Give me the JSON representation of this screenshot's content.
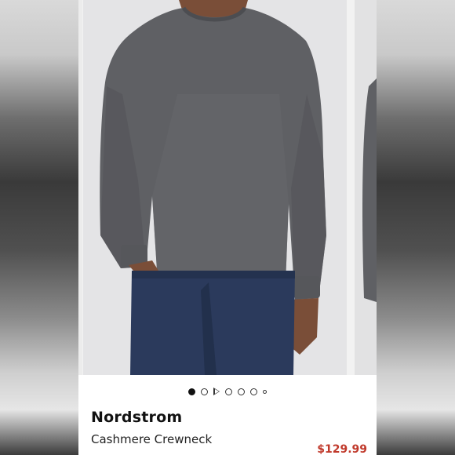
{
  "product": {
    "brand": "Nordstrom",
    "title": "Cashmere Crewneck",
    "price": "$129.99"
  },
  "carousel": {
    "image_description_icon": "product-photo-grey-sweater",
    "active_index": 0,
    "indicators": [
      "dot",
      "dot",
      "video",
      "dot",
      "dot",
      "dot",
      "small-dot"
    ]
  },
  "colors": {
    "price_color": "#c0392b",
    "sweater": "#5f6064",
    "jeans": "#2b3a5c",
    "background": "#e4e4e6"
  }
}
